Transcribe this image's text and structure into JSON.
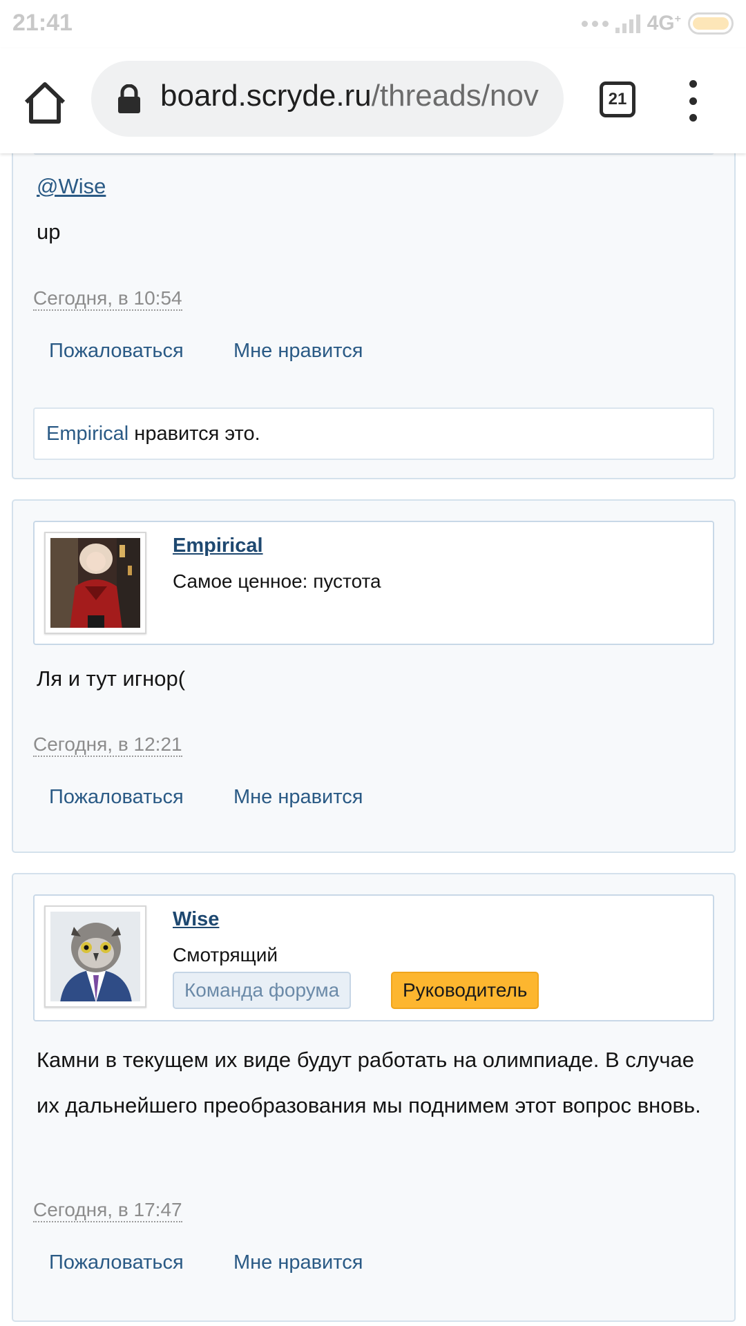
{
  "status_bar": {
    "time": "21:41",
    "network": "4G",
    "network_sup": "+"
  },
  "browser": {
    "url_host": "board.scryde.ru",
    "url_path": "/threads/nov",
    "tab_count": "21",
    "icons": [
      "home-icon",
      "lock-icon",
      "tab-switcher-icon",
      "more-vert-icon"
    ]
  },
  "posts": [
    {
      "mention": "@Wise",
      "text": "up",
      "date": "Сегодня, в 10:54",
      "report_label": "Пожаловаться",
      "like_label": "Мне нравится",
      "likes": {
        "user": "Empirical",
        "suffix": " нравится это."
      }
    },
    {
      "author": "Empirical",
      "author_title": "Самое ценное: пустота",
      "text": "Ля и тут игнор(",
      "date": "Сегодня, в 12:21",
      "report_label": "Пожаловаться",
      "like_label": "Мне нравится"
    },
    {
      "author": "Wise",
      "author_title": "Смотрящий",
      "badges": [
        "Команда форума",
        "Руководитель"
      ],
      "text": "Камни в текущем их виде будут работать на олимпиаде. В случае их дальнейшего преобразования мы поднимем этот вопрос вновь.",
      "date": "Сегодня, в 17:47",
      "report_label": "Пожаловаться",
      "like_label": "Мне нравится"
    }
  ],
  "colors": {
    "link": "#2a5a85",
    "post_bg": "#f7f9fb",
    "post_border": "#d4e1ec",
    "lead_badge": "#fdb62f",
    "team_badge": "#e8eff6"
  }
}
